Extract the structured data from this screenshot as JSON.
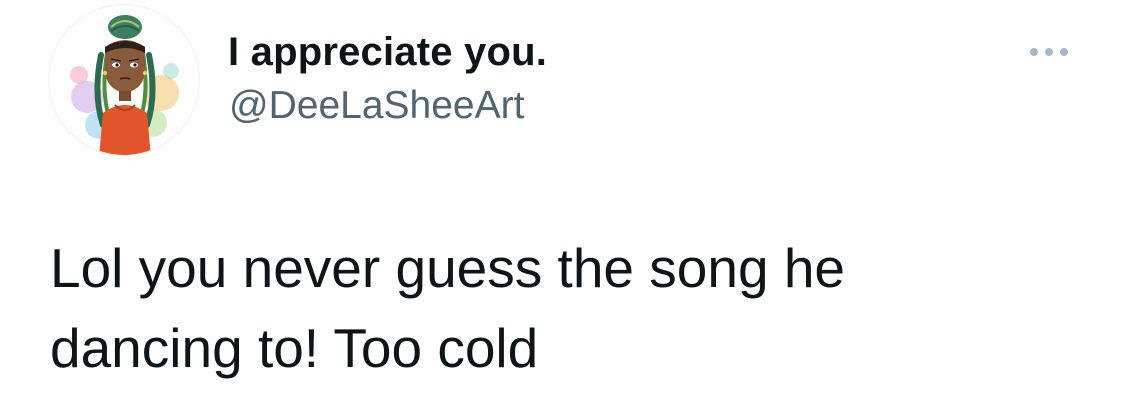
{
  "tweet": {
    "author": {
      "display_name": "I appreciate you.",
      "handle": "@DeeLaSheeArt",
      "avatar_icon": "illustrated-girl-avatar"
    },
    "more_icon": "more-dots-icon",
    "text_lines": [
      "Lol you never guess the song he",
      "dancing to! Too cold"
    ]
  },
  "colors": {
    "text_primary": "#0f1419",
    "text_secondary": "#536471",
    "more_dots": "#aab8c2",
    "avatar_shirt": "#e2552b",
    "avatar_skin": "#8a5a3c",
    "avatar_hair": "#2d6b4f"
  }
}
